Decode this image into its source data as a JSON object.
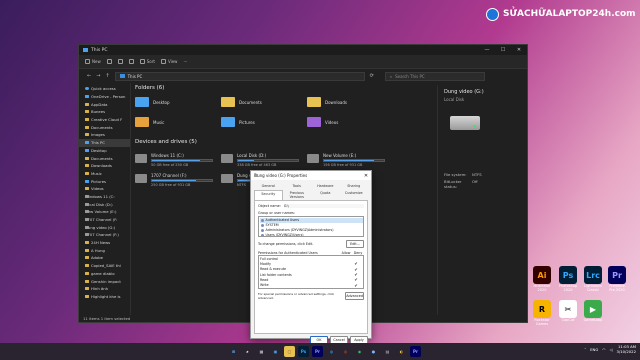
{
  "watermark": {
    "text": "SỬACHỮALAPTOP24h.com"
  },
  "explorer": {
    "title": "This PC",
    "controls": {
      "minimize": "—",
      "maximize": "☐",
      "close": "✕"
    },
    "toolbar": {
      "new_label": "New",
      "sort_label": "Sort",
      "view_label": "View",
      "more_label": "···"
    },
    "address": "This PC",
    "search_placeholder": "Search This PC",
    "sidebar": [
      {
        "label": "Quick access",
        "icon": "star"
      },
      {
        "label": "OneDrive - Person",
        "icon": "blue"
      },
      {
        "label": "AppData",
        "icon": "folder"
      },
      {
        "label": "Bunees",
        "icon": "folder"
      },
      {
        "label": "Creative Cloud F",
        "icon": "folder"
      },
      {
        "label": "Documents",
        "icon": "folder"
      },
      {
        "label": "Images",
        "icon": "folder"
      },
      {
        "label": "This PC",
        "icon": "blue",
        "active": true
      },
      {
        "label": "Desktop",
        "icon": "blue"
      },
      {
        "label": "Documents",
        "icon": "folder"
      },
      {
        "label": "Downloads",
        "icon": "folder"
      },
      {
        "label": "Music",
        "icon": "folder"
      },
      {
        "label": "Pictures",
        "icon": "blue"
      },
      {
        "label": "Videos",
        "icon": "folder"
      },
      {
        "label": "Windows 11 (C:",
        "icon": "drive"
      },
      {
        "label": "Local Disk (D:)",
        "icon": "drive"
      },
      {
        "label": "New Volume (E:)",
        "icon": "drive"
      },
      {
        "label": "1707 Channel (F:",
        "icon": "drive"
      },
      {
        "label": "Dung video (G:)",
        "icon": "drive"
      },
      {
        "label": "1707 Channel (F:)",
        "icon": "drive"
      },
      {
        "label": "24H News",
        "icon": "folder"
      },
      {
        "label": "A Hung",
        "icon": "folder"
      },
      {
        "label": "Adobe",
        "icon": "folder"
      },
      {
        "label": "Copied_SAIE thi",
        "icon": "folder"
      },
      {
        "label": "game diablo",
        "icon": "folder"
      },
      {
        "label": "Genshin impact",
        "icon": "folder"
      },
      {
        "label": "Hình ảnh",
        "icon": "folder"
      },
      {
        "label": "Highlight khe is",
        "icon": "folder"
      }
    ],
    "folders_title": "Folders (6)",
    "folders": [
      {
        "name": "Desktop",
        "icon": "blue"
      },
      {
        "name": "Documents",
        "icon": "folder"
      },
      {
        "name": "Downloads",
        "icon": "folder"
      },
      {
        "name": "Music",
        "icon": "orange"
      },
      {
        "name": "Pictures",
        "icon": "blue"
      },
      {
        "name": "Videos",
        "icon": "purple"
      }
    ],
    "drives_title": "Devices and drives (5)",
    "drives": [
      {
        "name": "Windows 11 (C:)",
        "free": "50 GB free of 250 GB",
        "used": 0.8
      },
      {
        "name": "Local Disk (D:)",
        "free": "338 GB free of 463 GB",
        "used": 0.27
      },
      {
        "name": "New Volume (E:)",
        "free": "156 GB free of 931 GB",
        "used": 0.83
      },
      {
        "name": "1707 Channel (F:)",
        "free": "250 GB free of 931 GB",
        "used": 0.73
      },
      {
        "name": "Dung video (G:)",
        "free": "NTFS",
        "used": 0.5
      }
    ],
    "details": {
      "title": "Dung video (G:)",
      "subtitle": "Local Disk",
      "fs_label": "File system:",
      "fs_value": "NTFS",
      "bitlocker_label": "BitLocker status:",
      "bitlocker_value": "Off"
    },
    "status": "11 items   1 item selected"
  },
  "dialog": {
    "title": "Dung video (G:) Properties",
    "close": "✕",
    "tabs": [
      "General",
      "Tools",
      "Hardware",
      "Sharing",
      "Security",
      "Previous Versions",
      "Quota",
      "Customize"
    ],
    "active_tab": "Security",
    "object_label": "Object name:",
    "object_value": "G:\\",
    "group_label": "Group or user names:",
    "users": [
      {
        "name": "Authenticated Users",
        "selected": true
      },
      {
        "name": "SYSTEM",
        "selected": false
      },
      {
        "name": "Administrators (DYVINGZ\\Administrators)",
        "selected": false
      },
      {
        "name": "Users (DYVINGZ\\Users)",
        "selected": false
      }
    ],
    "change_text": "To change permissions, click Edit.",
    "edit_label": "Edit...",
    "perm_for": "Permissions for Authenticated Users",
    "allow_label": "Allow",
    "deny_label": "Deny",
    "permissions": [
      {
        "name": "Full control",
        "allow": "",
        "deny": ""
      },
      {
        "name": "Modify",
        "allow": "",
        "deny": "✔"
      },
      {
        "name": "Read & execute",
        "allow": "",
        "deny": "✔"
      },
      {
        "name": "List folder contents",
        "allow": "",
        "deny": "✔"
      },
      {
        "name": "Read",
        "allow": "",
        "deny": "✔"
      },
      {
        "name": "Write",
        "allow": "",
        "deny": "✔"
      }
    ],
    "special_text": "For special permissions or advanced settings, click Advanced.",
    "advanced_label": "Advanced",
    "ok_label": "OK",
    "cancel_label": "Cancel",
    "apply_label": "Apply"
  },
  "desktop_apps": [
    {
      "label": "Illustrator 2020",
      "short": "Ai",
      "bg": "#330000",
      "fg": "#ff9a00"
    },
    {
      "label": "Photoshop 2020",
      "short": "Ps",
      "bg": "#001e36",
      "fg": "#31a8ff"
    },
    {
      "label": "Lightroom Classic",
      "short": "Lrc",
      "bg": "#001e36",
      "fg": "#31a8ff"
    },
    {
      "label": "Premiere Pro 2020",
      "short": "Pr",
      "bg": "#00005b",
      "fg": "#9999ff"
    },
    {
      "label": "Rockstar Games",
      "short": "R",
      "bg": "#f6b300",
      "fg": "#000000"
    },
    {
      "label": "CapCut",
      "short": "✂",
      "bg": "#ffffff",
      "fg": "#000000"
    },
    {
      "label": "GameLoop",
      "short": "▶",
      "bg": "#3aaa4b",
      "fg": "#ffffff"
    }
  ],
  "taskbar": {
    "apps": [
      {
        "short": "⊞",
        "bg": "#2a2430",
        "fg": "#5aaaf0"
      },
      {
        "short": "⌕",
        "bg": "#2a2430",
        "fg": "#ffffff"
      },
      {
        "short": "▦",
        "bg": "#2a2430",
        "fg": "#dddddd"
      },
      {
        "short": "▣",
        "bg": "#2a2430",
        "fg": "#4aa3f0"
      },
      {
        "short": "▢",
        "bg": "#e7c152",
        "fg": "#6a4a10"
      },
      {
        "short": "Ps",
        "bg": "#001e36",
        "fg": "#31a8ff"
      },
      {
        "short": "Pr",
        "bg": "#00005b",
        "fg": "#9999ff"
      },
      {
        "short": "◍",
        "bg": "#2a2430",
        "fg": "#2ea8e8"
      },
      {
        "short": "◎",
        "bg": "#2a2430",
        "fg": "#e95a2b"
      },
      {
        "short": "◉",
        "bg": "#2a2430",
        "fg": "#34c06a"
      },
      {
        "short": "●",
        "bg": "#2a2430",
        "fg": "#7ab6ff"
      },
      {
        "short": "▤",
        "bg": "#2a2430",
        "fg": "#cccccc"
      },
      {
        "short": "◐",
        "bg": "#2a2430",
        "fg": "#f0c050"
      },
      {
        "short": "Pr",
        "bg": "#00005b",
        "fg": "#9999ff"
      }
    ],
    "tray": {
      "lang": "ENG",
      "time": "11:03 AM",
      "date": "3/10/2022"
    }
  }
}
